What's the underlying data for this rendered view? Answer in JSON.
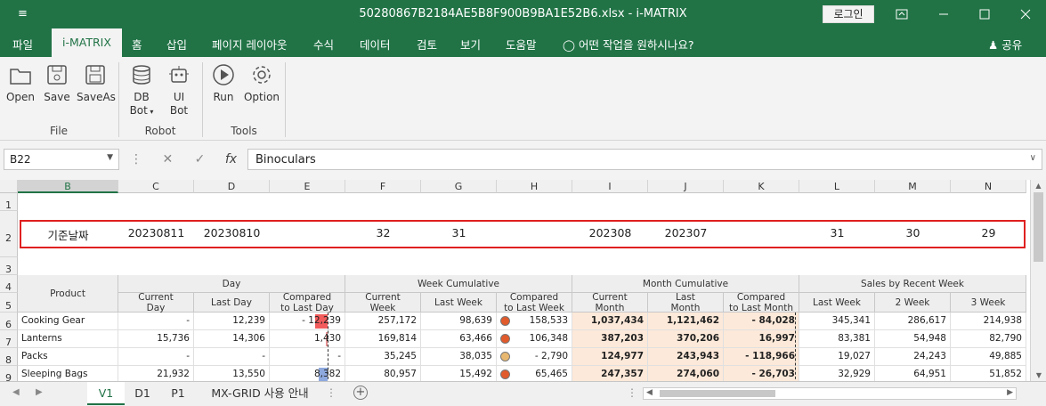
{
  "titlebar": {
    "qat": "≡",
    "title": "50280867B2184AE5B8F900B9BA1E52B6.xlsx - i-MATRIX",
    "login": "로그인"
  },
  "tabs": [
    "파일",
    "i-MATRIX",
    "홈",
    "삽입",
    "페이지 레이아웃",
    "수식",
    "데이터",
    "검토",
    "보기",
    "도움말",
    "어떤 작업을 원하시나요?"
  ],
  "share": "공유",
  "ribbon": {
    "open": "Open",
    "save": "Save",
    "saveas": "SaveAs",
    "dbbot": "DB",
    "dbbot2": "Bot",
    "uibot": "UI",
    "uibot2": "Bot",
    "run": "Run",
    "option": "Option",
    "group_file": "File",
    "group_robot": "Robot",
    "group_tools": "Tools"
  },
  "formula": {
    "namebox": "B22",
    "fx": "fx",
    "value": "Binoculars"
  },
  "columns": [
    "B",
    "C",
    "D",
    "E",
    "F",
    "G",
    "H",
    "I",
    "J",
    "K",
    "L",
    "M",
    "N"
  ],
  "rows": [
    "1",
    "2",
    "3",
    "4",
    "5",
    "6",
    "7",
    "8",
    "9"
  ],
  "row2": [
    "기준날짜",
    "20230811",
    "20230810",
    "",
    "32",
    "31",
    "",
    "202308",
    "202307",
    "",
    "31",
    "30",
    "29"
  ],
  "header": {
    "product": "Product",
    "day": "Day",
    "week": "Week Cumulative",
    "month": "Month Cumulative",
    "recent": "Sales by Recent Week",
    "sub": [
      "Current\nDay",
      "Last Day",
      "Compared\nto Last Day",
      "Current\nWeek",
      "Last Week",
      "Compared\nto Last Week",
      "Current\nMonth",
      "Last\nMonth",
      "Compared\nto Last Month",
      "Last Week",
      "2 Week",
      "3 Week"
    ]
  },
  "data": [
    [
      "Cooking Gear",
      "-",
      "12,239",
      "- 12,239",
      "257,172",
      "98,639",
      "158,533",
      "1,037,434",
      "1,121,462",
      "- 84,028",
      "345,341",
      "286,617",
      "214,938"
    ],
    [
      "Lanterns",
      "15,736",
      "14,306",
      "1,430",
      "169,814",
      "63,466",
      "106,348",
      "387,203",
      "370,206",
      "16,997",
      "83,381",
      "54,948",
      "82,790"
    ],
    [
      "Packs",
      "-",
      "-",
      "-",
      "35,245",
      "38,035",
      "- 2,790",
      "124,977",
      "243,943",
      "- 118,966",
      "19,027",
      "24,243",
      "49,885"
    ],
    [
      "Sleeping Bags",
      "21,932",
      "13,550",
      "8,382",
      "80,957",
      "15,492",
      "65,465",
      "247,357",
      "274,060",
      "- 26,703",
      "32,929",
      "64,951",
      "51,852"
    ]
  ],
  "dots": [
    "#e05a2b",
    "#e05a2b",
    "#e8b870",
    "#e05a2b"
  ],
  "sheets": [
    "V1",
    "D1",
    "P1",
    "MX-GRID 사용 안내"
  ],
  "colors": {
    "accent": "#217346",
    "highlight": "#e02020",
    "peach": "#fde9d9"
  }
}
